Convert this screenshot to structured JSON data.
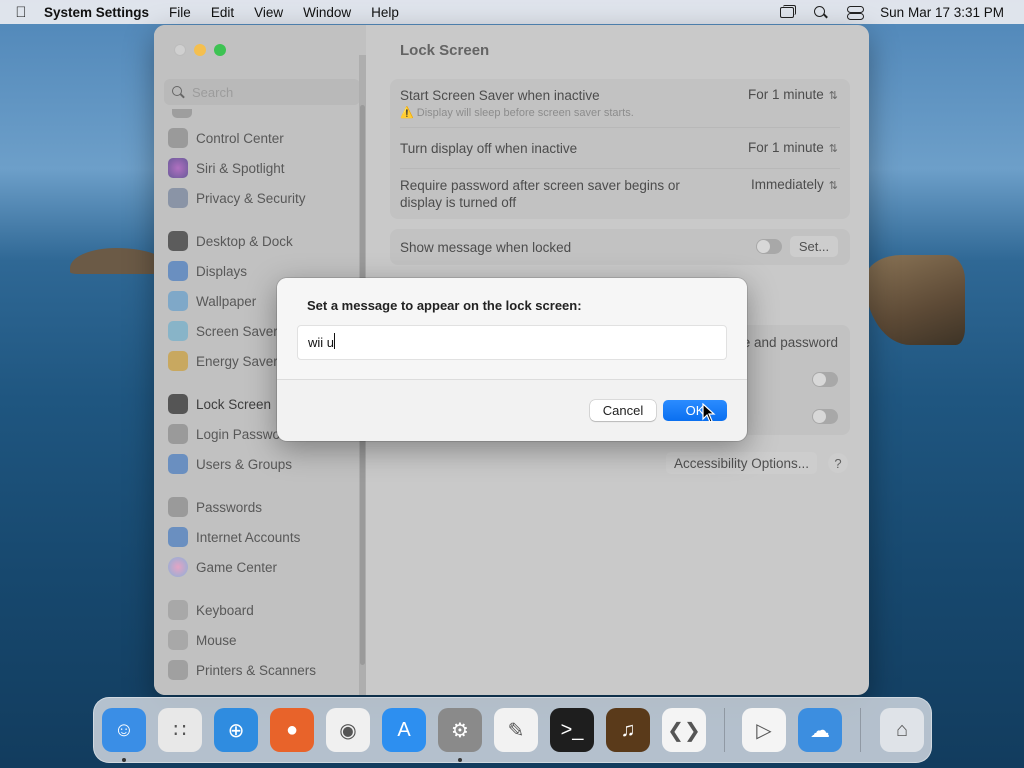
{
  "menubar": {
    "app_name": "System Settings",
    "menus": [
      "File",
      "Edit",
      "View",
      "Window",
      "Help"
    ],
    "datetime": "Sun Mar 17  3:31 PM"
  },
  "search": {
    "placeholder": "Search"
  },
  "sidebar": {
    "items": [
      {
        "label": "Control Center",
        "icon": "control-center-icon",
        "color": "#9a9a9a"
      },
      {
        "label": "Siri & Spotlight",
        "icon": "siri-icon",
        "color": "#8a6a9a"
      },
      {
        "label": "Privacy & Security",
        "icon": "hand-icon",
        "color": "#8a94a6"
      },
      {
        "label": "Desktop & Dock",
        "icon": "dock-icon",
        "color": "#5c5c5c"
      },
      {
        "label": "Displays",
        "icon": "sun-icon",
        "color": "#6a8fc0"
      },
      {
        "label": "Wallpaper",
        "icon": "wallpaper-icon",
        "color": "#7fa8c8"
      },
      {
        "label": "Screen Saver",
        "icon": "screen-saver-icon",
        "color": "#88b4c8"
      },
      {
        "label": "Energy Saver",
        "icon": "bulb-icon",
        "color": "#c8a860"
      },
      {
        "label": "Lock Screen",
        "icon": "lock-icon",
        "color": "#555555"
      },
      {
        "label": "Login Password",
        "icon": "login-lock-icon",
        "color": "#9a9a9a"
      },
      {
        "label": "Users & Groups",
        "icon": "users-icon",
        "color": "#6a8fc0"
      },
      {
        "label": "Passwords",
        "icon": "key-icon",
        "color": "#9a9a9a"
      },
      {
        "label": "Internet Accounts",
        "icon": "at-icon",
        "color": "#6a8fc0"
      },
      {
        "label": "Game Center",
        "icon": "game-center-icon",
        "color": "#b48ac0"
      },
      {
        "label": "Keyboard",
        "icon": "keyboard-icon",
        "color": "#a8a8a8"
      },
      {
        "label": "Mouse",
        "icon": "mouse-icon",
        "color": "#a8a8a8"
      },
      {
        "label": "Printers & Scanners",
        "icon": "printer-icon",
        "color": "#a0a0a0"
      }
    ]
  },
  "content": {
    "title": "Lock Screen",
    "rows": [
      {
        "label": "Start Screen Saver when inactive",
        "sublabel": "⚠️ Display will sleep before screen saver starts.",
        "value": "For 1 minute"
      },
      {
        "label": "Turn display off when inactive",
        "value": "For 1 minute"
      },
      {
        "label": "Require password after screen saver begins or",
        "label2": "display is turned off",
        "value": "Immediately"
      }
    ],
    "message_row": {
      "label": "Show message when locked",
      "button": "Set..."
    },
    "partial_text": "e and password",
    "accessibility_button": "Accessibility Options...",
    "help_button": "?"
  },
  "dialog": {
    "prompt": "Set a message to appear on the lock screen:",
    "input_value": "wii u",
    "cancel_label": "Cancel",
    "ok_label": "OK"
  },
  "dock": {
    "apps": [
      {
        "name": "finder",
        "color": "#3a8ee6",
        "glyph": "☺",
        "running": true
      },
      {
        "name": "launchpad",
        "color": "#e8e8e8",
        "glyph": "∷",
        "running": false
      },
      {
        "name": "safari",
        "color": "#2f8ce0",
        "glyph": "⊕",
        "running": false
      },
      {
        "name": "firefox",
        "color": "#e8632a",
        "glyph": "●",
        "running": false
      },
      {
        "name": "chrome",
        "color": "#f0f0f0",
        "glyph": "◉",
        "running": false
      },
      {
        "name": "app-store",
        "color": "#2d8ff0",
        "glyph": "A",
        "running": false
      },
      {
        "name": "system-settings",
        "color": "#8a8a8a",
        "glyph": "⚙",
        "running": true
      },
      {
        "name": "textedit",
        "color": "#f2f2f2",
        "glyph": "✎",
        "running": false
      },
      {
        "name": "terminal",
        "color": "#1e1e1e",
        "glyph": ">_",
        "running": false
      },
      {
        "name": "garageband",
        "color": "#5a3a1a",
        "glyph": "♫",
        "running": false
      },
      {
        "name": "vscode",
        "color": "#f4f4f4",
        "glyph": "❮❯",
        "running": false
      },
      {
        "name": "visual-studio",
        "color": "#f4f4f4",
        "glyph": "▷",
        "running": false
      },
      {
        "name": "weather",
        "color": "#3c8ee0",
        "glyph": "☁",
        "running": false
      },
      {
        "name": "trash",
        "color": "#dfe3e8",
        "glyph": "⌂",
        "running": false
      }
    ]
  }
}
